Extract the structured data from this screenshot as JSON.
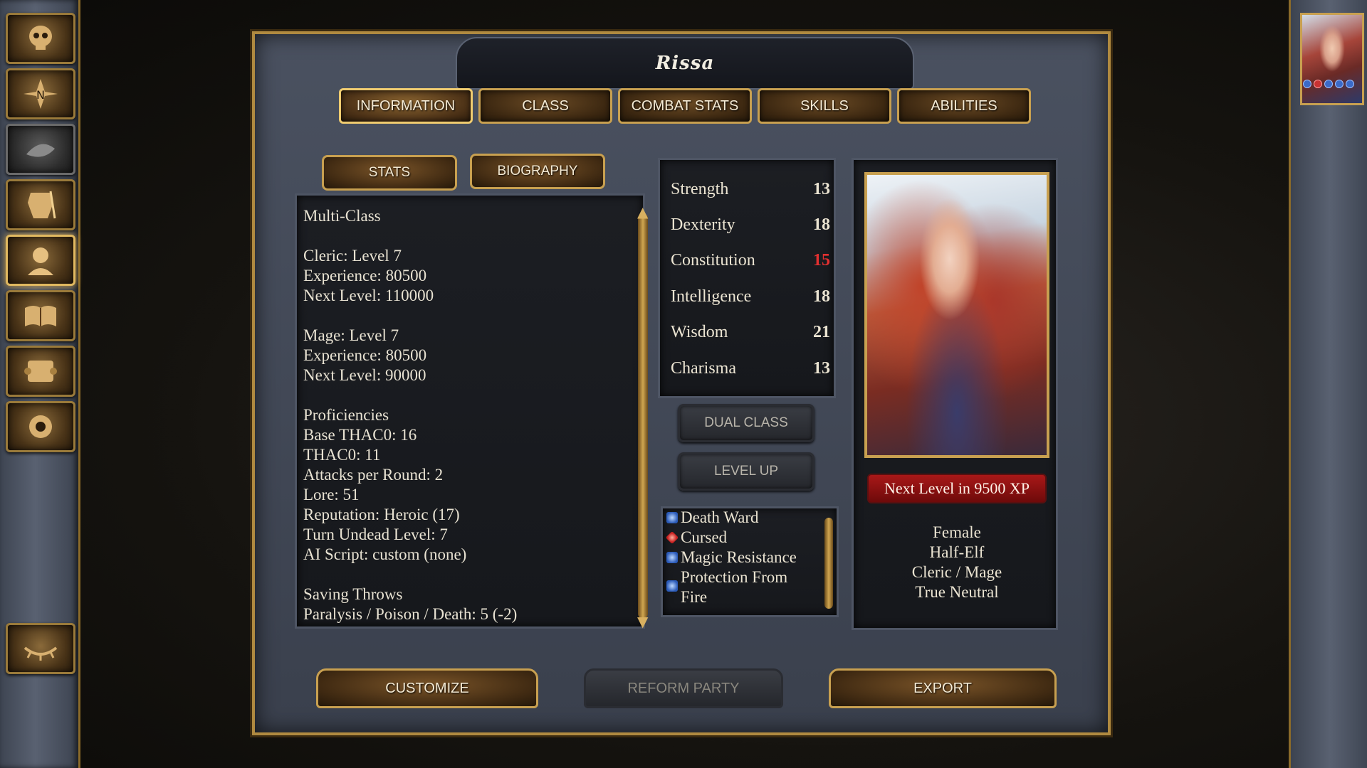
{
  "character": {
    "name": "Rissa"
  },
  "tabs": [
    "INFORMATION",
    "CLASS",
    "COMBAT STATS",
    "SKILLS",
    "ABILITIES"
  ],
  "subtabs": {
    "stats": "STATS",
    "biography": "BIOGRAPHY"
  },
  "info": {
    "class_type": "Multi-Class",
    "cleric_level": "Cleric: Level 7",
    "cleric_xp": "Experience: 80500",
    "cleric_next": "Next Level: 110000",
    "mage_level": "Mage: Level 7",
    "mage_xp": "Experience: 80500",
    "mage_next": "Next Level: 90000",
    "proficiencies": "Proficiencies",
    "base_thac0": "Base THAC0: 16",
    "thac0": "THAC0: 11",
    "attacks": "Attacks per Round: 2",
    "lore": "Lore: 51",
    "reputation": "Reputation: Heroic (17)",
    "turn_undead": "Turn Undead Level: 7",
    "ai_script": "AI Script: custom (none)",
    "saving_throws": "Saving Throws",
    "paralysis": "Paralysis / Poison / Death: 5 (-2)"
  },
  "stats": [
    {
      "name": "Strength",
      "value": "13",
      "penalized": false
    },
    {
      "name": "Dexterity",
      "value": "18",
      "penalized": false
    },
    {
      "name": "Constitution",
      "value": "15",
      "penalized": true
    },
    {
      "name": "Intelligence",
      "value": "18",
      "penalized": false
    },
    {
      "name": "Wisdom",
      "value": "21",
      "penalized": false
    },
    {
      "name": "Charisma",
      "value": "13",
      "penalized": false
    }
  ],
  "buttons": {
    "dual_class": "DUAL CLASS",
    "level_up": "LEVEL UP",
    "customize": "CUSTOMIZE",
    "reform_party": "REFORM PARTY",
    "export": "EXPORT"
  },
  "effects": {
    "death_ward": "Death Ward",
    "cursed": "Cursed",
    "magic_resistance": "Magic Resistance",
    "protection_from_fire": "Protection From Fire"
  },
  "next_level_text": "Next Level in 9500 XP",
  "bio": {
    "gender": "Female",
    "race": "Half-Elf",
    "class": "Cleric / Mage",
    "alignment": "True Neutral"
  },
  "sidebar_icons": [
    "skull-icon",
    "compass-map-icon",
    "journal-icon",
    "armor-inventory-icon",
    "character-record-icon",
    "mage-book-icon",
    "priest-scroll-icon",
    "options-gear-icon",
    "rest-eye-icon"
  ],
  "colors": {
    "gold_border": "#c8a050",
    "penalty_red": "#e23030",
    "xp_bar_red": "#a81818"
  }
}
